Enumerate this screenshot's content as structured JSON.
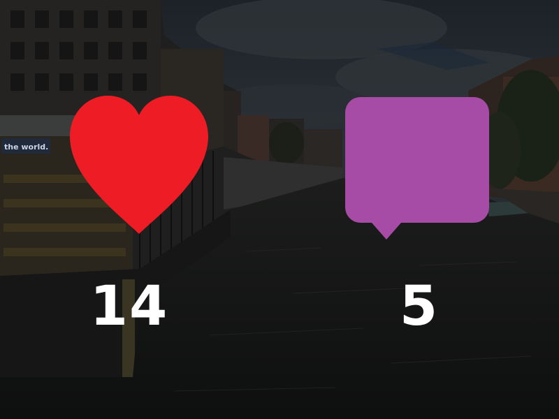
{
  "overlay": {
    "likes": {
      "icon": "heart-icon",
      "color": "#ee1c24",
      "count": "14"
    },
    "comments": {
      "icon": "speech-bubble-icon",
      "color": "#a64ca6",
      "count": "5"
    }
  },
  "background": {
    "scene": "canal-with-buildings-dimmed-photo"
  }
}
